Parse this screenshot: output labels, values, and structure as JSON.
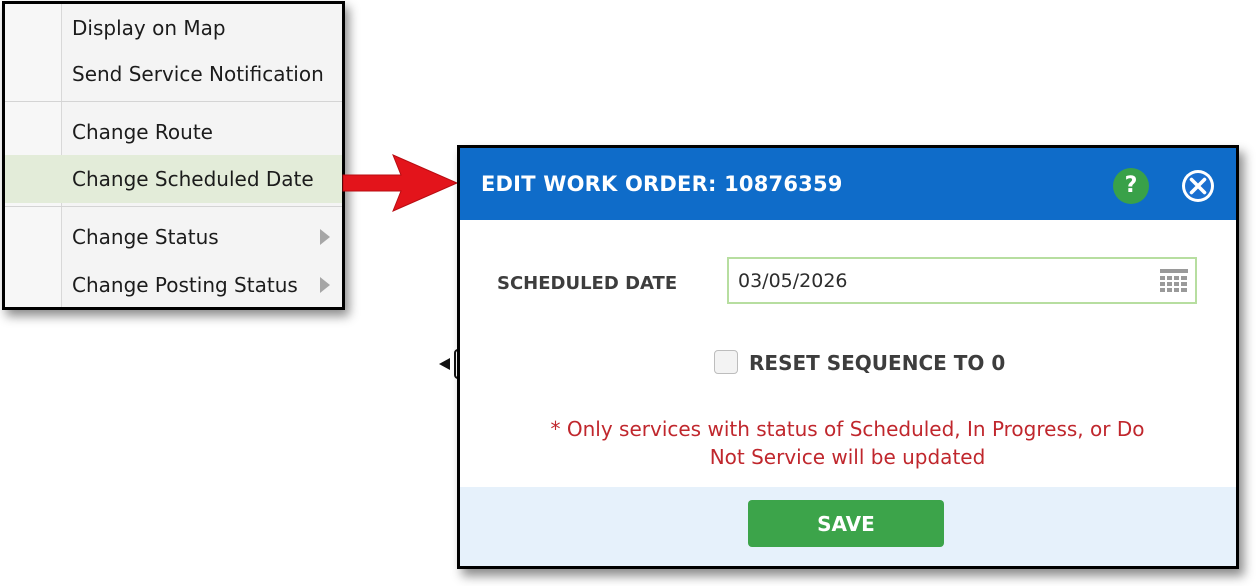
{
  "context_menu": {
    "items": [
      {
        "label": "Display on Map"
      },
      {
        "label": "Send Service Notification"
      },
      {
        "label": "Change Route"
      },
      {
        "label": "Change Scheduled Date",
        "highlighted": true
      },
      {
        "label": "Change Status",
        "has_submenu": true
      },
      {
        "label": "Change Posting Status",
        "has_submenu": true
      }
    ],
    "highlight_color": "#e3ecd9"
  },
  "annotation": {
    "arrow_color": "#e3141b",
    "icon": "red-arrow-icon"
  },
  "dialog": {
    "title": "EDIT WORK ORDER: 10876359",
    "header_color": "#0f6cc9",
    "help_icon": "?",
    "close_icon": "close-icon",
    "scheduled_date_label": "SCHEDULED DATE",
    "scheduled_date_value": "03/05/2026",
    "reset_sequence_label": "RESET SEQUENCE TO 0",
    "reset_sequence_checked": false,
    "notice_line1": "* Only services with status of Scheduled, In Progress, or Do",
    "notice_line2": "Not Service will be updated",
    "notice_color": "#c0272d",
    "save_label": "SAVE",
    "save_color": "#3ca44a"
  }
}
